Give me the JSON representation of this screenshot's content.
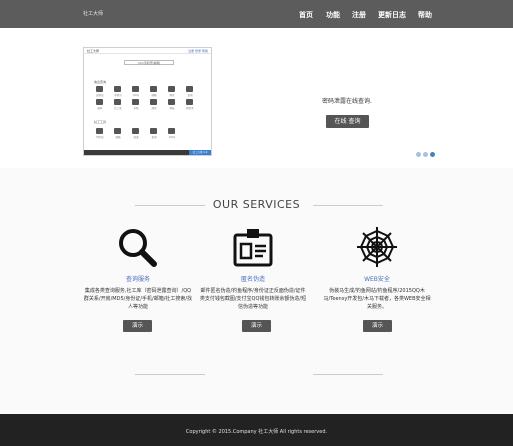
{
  "brand": "社工大师",
  "nav": [
    "首页",
    "功能",
    "注册",
    "更新日志",
    "帮助"
  ],
  "preview": {
    "title_left": "社工大师",
    "title_right": "注册 登录 帮助",
    "search_text": "QQ/手机号/邮箱",
    "section1": "信息查询",
    "section2": "社工工具",
    "icon_labels": [
      "身份证",
      "手机号",
      "QQ号",
      "邮箱",
      "开房",
      "查询",
      "密码",
      "社工库",
      "手机",
      "开房",
      "地址",
      "群关系",
      "IP定位",
      "邮箱",
      "快递",
      "查询",
      "QQ号"
    ],
    "foot_button": "社工大师 1.0"
  },
  "hero": {
    "text": "密码泄露在线查询.",
    "button": "在线 查询"
  },
  "slider_dots": [
    "#a8c2dc",
    "#a8c2dc",
    "#4a80c0"
  ],
  "services": {
    "title": "OUR SERVICES",
    "items": [
      {
        "name": "查询服务",
        "icon": "magnifier-icon",
        "desc": "集成各类查询服务,社工库（密码泄露查询）/QQ群关系/开房/MD5/身份证/手机/邮箱/社工搜索/找人等功能",
        "button": "演示"
      },
      {
        "name": "匿名伪造",
        "icon": "id-badge-icon",
        "desc": "邮件匿名伪造/钓鱼程序/身份证正反面伪造/证件类支付钱包截图/支付宝QQ钱包转账余额伪造/短信伪造等功能",
        "button": "演示"
      },
      {
        "name": "WEB安全",
        "icon": "spiderweb-icon",
        "desc": "伪装马生成/钓鱼网站/钓鱼程序/2015QQ木马/Teensy开发包/木马下载者，各类WEB安全相关服务。",
        "button": "演示"
      }
    ]
  },
  "footer": "Copyright © 2015.Company 社工大师 All rights reserved."
}
